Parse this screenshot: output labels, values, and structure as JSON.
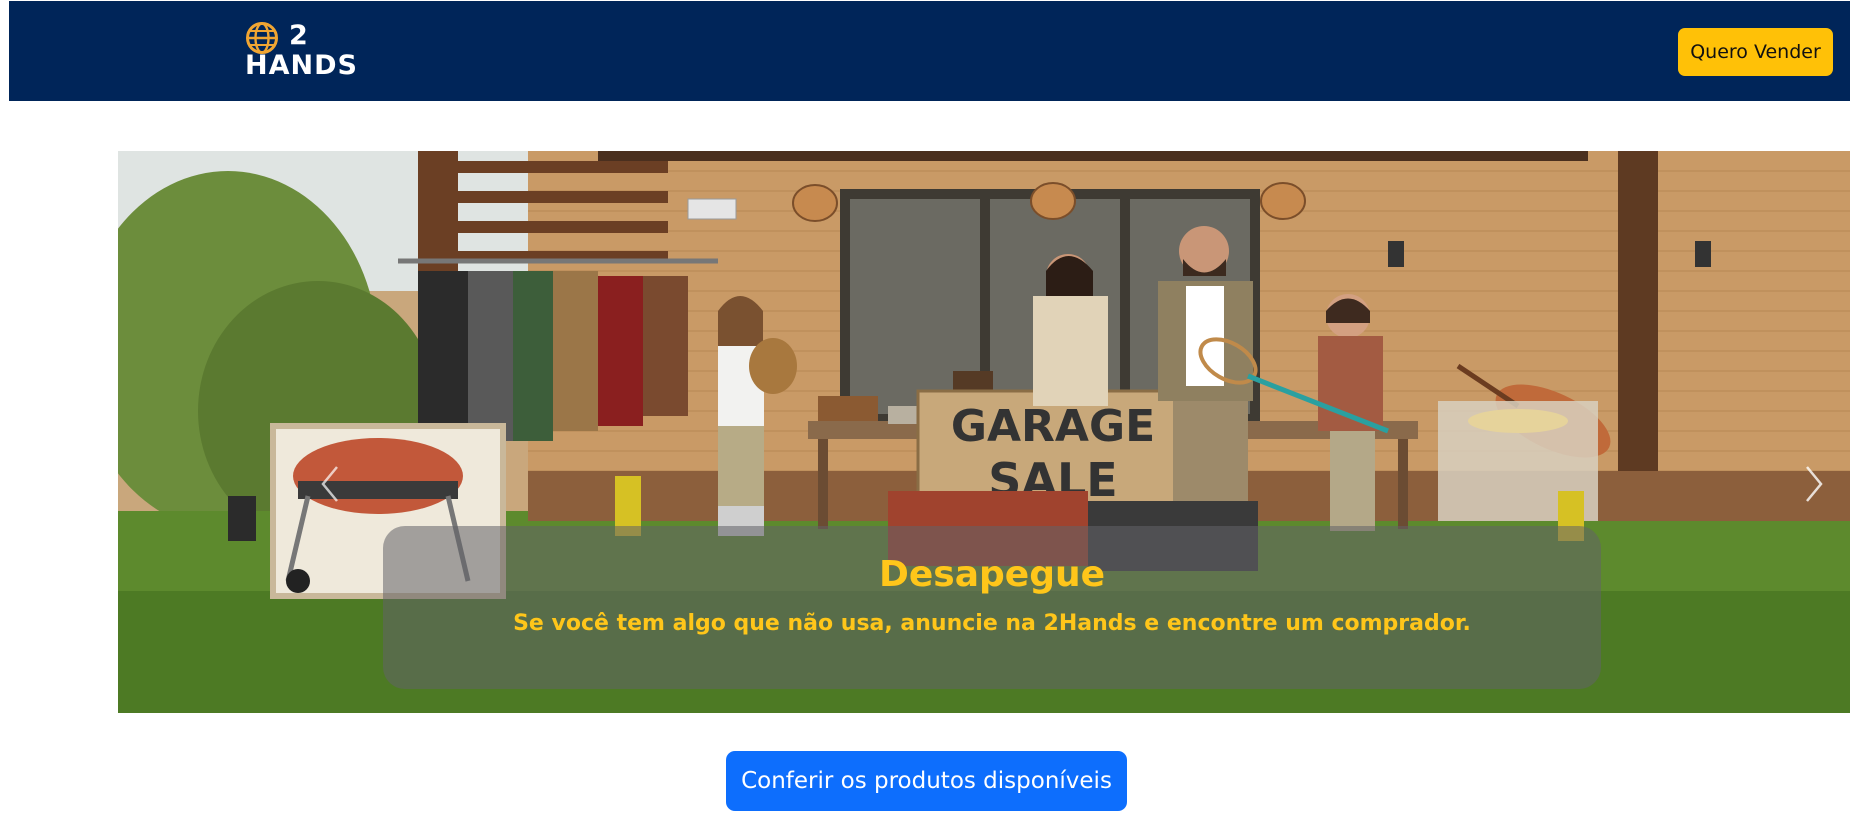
{
  "header": {
    "logo_number": "2",
    "logo_word": "HANDS",
    "sell_button_label": "Quero Vender"
  },
  "carousel": {
    "sign_line1": "GARAGE",
    "sign_line2": "SALE",
    "caption_title": "Desapegue",
    "caption_text": "Se você tem algo que não usa, anuncie na 2Hands e encontre um comprador."
  },
  "main": {
    "cta_label": "Conferir os produtos disponíveis"
  },
  "colors": {
    "navbar": "#002559",
    "accent_yellow": "#ffc107",
    "primary_blue": "#0d6efd"
  }
}
